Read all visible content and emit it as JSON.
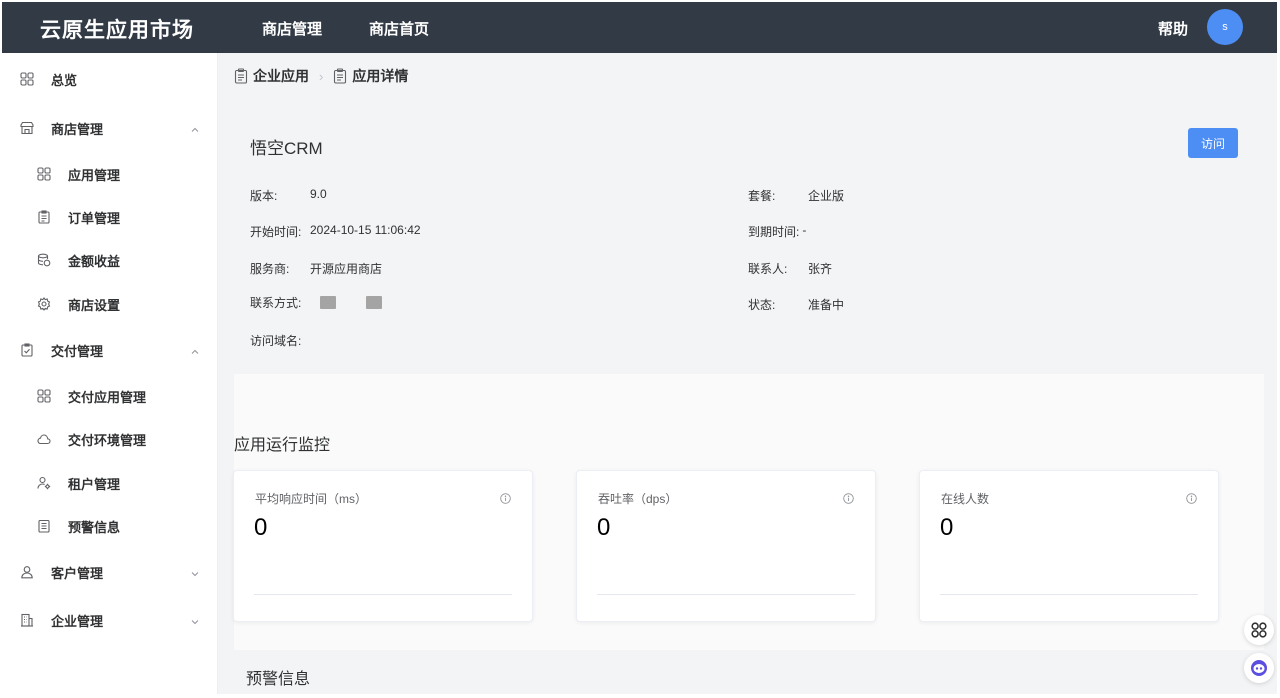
{
  "header": {
    "logo": "云原生应用市场",
    "nav": [
      "商店管理",
      "商店首页"
    ],
    "help": "帮助",
    "avatar": "s"
  },
  "sidebar": {
    "items": [
      {
        "label": "总览",
        "icon": "grid-icon"
      },
      {
        "label": "商店管理",
        "icon": "store-icon",
        "expanded": true
      },
      {
        "label": "应用管理",
        "icon": "grid-icon"
      },
      {
        "label": "订单管理",
        "icon": "clipboard-icon"
      },
      {
        "label": "金额收益",
        "icon": "database-icon"
      },
      {
        "label": "商店设置",
        "icon": "gear-icon"
      },
      {
        "label": "交付管理",
        "icon": "checklist-icon",
        "expanded": true
      },
      {
        "label": "交付应用管理",
        "icon": "grid-icon"
      },
      {
        "label": "交付环境管理",
        "icon": "cloud-icon"
      },
      {
        "label": "租户管理",
        "icon": "user-gear-icon"
      },
      {
        "label": "预警信息",
        "icon": "document-icon"
      },
      {
        "label": "客户管理",
        "icon": "user-icon",
        "expanded": false
      },
      {
        "label": "企业管理",
        "icon": "building-icon",
        "expanded": false
      }
    ]
  },
  "breadcrumb": [
    "企业应用",
    "应用详情"
  ],
  "app": {
    "name": "悟空CRM",
    "visit_label": "访问",
    "fields": {
      "version": {
        "label": "版本:",
        "value": "9.0"
      },
      "package": {
        "label": "套餐:",
        "value": "企业版"
      },
      "start_time": {
        "label": "开始时间:",
        "value": "2024-10-15 11:06:42"
      },
      "expire_time": {
        "label": "到期时间:",
        "value": "-"
      },
      "provider": {
        "label": "服务商:",
        "value": "开源应用商店"
      },
      "contact_person": {
        "label": "联系人:",
        "value": "张齐"
      },
      "contact_method": {
        "label": "联系方式:"
      },
      "status": {
        "label": "状态:",
        "value": "准备中"
      },
      "domain": {
        "label": "访问域名:",
        "value": ""
      }
    }
  },
  "monitor": {
    "title": "应用运行监控",
    "cards": [
      {
        "title": "平均响应时间（ms）",
        "value": "0"
      },
      {
        "title": "吞吐率（dps）",
        "value": "0"
      },
      {
        "title": "在线人数",
        "value": "0"
      }
    ]
  },
  "alerts": {
    "title": "预警信息"
  },
  "colors": {
    "header_bg": "#323a46",
    "accent": "#4d8ef4",
    "status_green": "#3a9a1f"
  }
}
